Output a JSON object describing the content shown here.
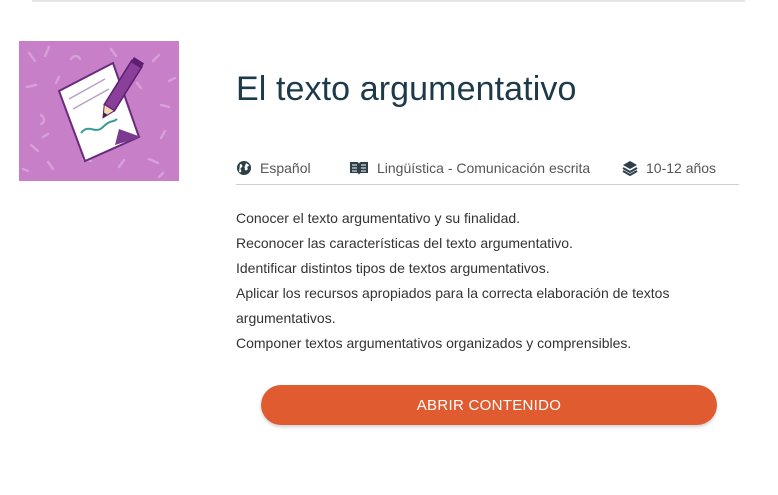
{
  "course": {
    "title": "El texto argumentativo",
    "thumbnail_icon": "writing-paper-pencil-icon",
    "thumbnail_bg_color": "#c77fc8",
    "meta": {
      "language": {
        "icon": "globe-icon",
        "label": "Español"
      },
      "subject": {
        "icon": "book-icon",
        "label": "Lingüística - Comunicación escrita"
      },
      "age": {
        "icon": "layers-icon",
        "label": "10-12 años"
      }
    },
    "objectives": [
      "Conocer el texto argumentativo y su finalidad.",
      "Reconocer las características del texto argumentativo.",
      "Identificar distintos tipos de textos argumentativos.",
      "Aplicar los recursos apropiados para la correcta elaboración de textos argumentativos.",
      "Componer textos argumentativos organizados y comprensibles."
    ],
    "open_button_label": "ABRIR CONTENIDO",
    "accent_color": "#e15b31"
  }
}
